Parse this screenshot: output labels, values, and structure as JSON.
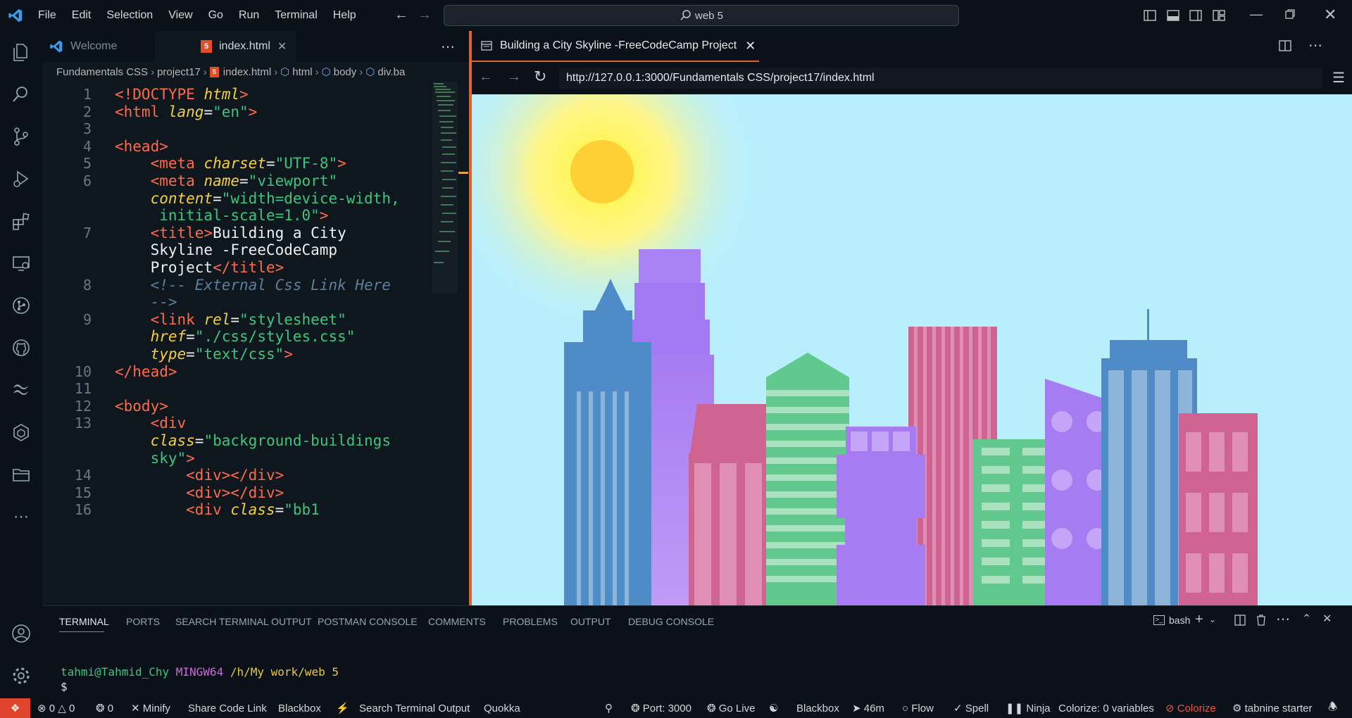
{
  "menu": [
    "File",
    "Edit",
    "Selection",
    "View",
    "Go",
    "Run",
    "Terminal",
    "Help"
  ],
  "search": {
    "text": "web 5"
  },
  "tabs": {
    "welcome": "Welcome",
    "index": "index.html"
  },
  "breadcrumb": [
    "Fundamentals CSS",
    "project17",
    "index.html",
    "html",
    "body",
    "div.ba"
  ],
  "code_lines": [
    {
      "n": "1",
      "parts": [
        [
          "tg",
          "<!DOCTYPE "
        ],
        [
          "at",
          "html"
        ],
        [
          "tg",
          ">"
        ]
      ]
    },
    {
      "n": "2",
      "parts": [
        [
          "tg",
          "<html "
        ],
        [
          "at",
          "lang"
        ],
        [
          "tx",
          "="
        ],
        [
          "st",
          "\"en\""
        ],
        [
          "tg",
          ">"
        ]
      ]
    },
    {
      "n": "3",
      "parts": []
    },
    {
      "n": "4",
      "parts": [
        [
          "tg",
          "<head>"
        ]
      ]
    },
    {
      "n": "5",
      "parts": [
        [
          "tx",
          "    "
        ],
        [
          "tg",
          "<meta "
        ],
        [
          "at",
          "charset"
        ],
        [
          "tx",
          "="
        ],
        [
          "st",
          "\"UTF-8\""
        ],
        [
          "tg",
          ">"
        ]
      ]
    },
    {
      "n": "6",
      "parts": [
        [
          "tx",
          "    "
        ],
        [
          "tg",
          "<meta "
        ],
        [
          "at",
          "name"
        ],
        [
          "tx",
          "="
        ],
        [
          "st",
          "\"viewport\""
        ]
      ]
    },
    {
      "n": "",
      "parts": [
        [
          "tx",
          "    "
        ],
        [
          "at",
          "content"
        ],
        [
          "tx",
          "="
        ],
        [
          "st",
          "\"width=device-width,"
        ]
      ]
    },
    {
      "n": "",
      "parts": [
        [
          "st",
          "     initial-scale=1.0\""
        ],
        [
          "tg",
          ">"
        ]
      ]
    },
    {
      "n": "7",
      "parts": [
        [
          "tx",
          "    "
        ],
        [
          "tg",
          "<title>"
        ],
        [
          "tx",
          "Building a City"
        ]
      ]
    },
    {
      "n": "",
      "parts": [
        [
          "tx",
          "    Skyline -FreeCodeCamp"
        ]
      ]
    },
    {
      "n": "",
      "parts": [
        [
          "tx",
          "    Project"
        ],
        [
          "tg",
          "</title>"
        ]
      ]
    },
    {
      "n": "8",
      "parts": [
        [
          "tx",
          "    "
        ],
        [
          "cm",
          "<!-- External Css Link Here"
        ]
      ]
    },
    {
      "n": "",
      "parts": [
        [
          "cm",
          "    -->"
        ]
      ]
    },
    {
      "n": "9",
      "parts": [
        [
          "tx",
          "    "
        ],
        [
          "tg",
          "<link "
        ],
        [
          "at",
          "rel"
        ],
        [
          "tx",
          "="
        ],
        [
          "st",
          "\"stylesheet\""
        ]
      ]
    },
    {
      "n": "",
      "parts": [
        [
          "tx",
          "    "
        ],
        [
          "at",
          "href"
        ],
        [
          "tx",
          "="
        ],
        [
          "st",
          "\"./css/styles.css\""
        ]
      ]
    },
    {
      "n": "",
      "parts": [
        [
          "tx",
          "    "
        ],
        [
          "at",
          "type"
        ],
        [
          "tx",
          "="
        ],
        [
          "st",
          "\"text/css\""
        ],
        [
          "tg",
          ">"
        ]
      ]
    },
    {
      "n": "10",
      "parts": [
        [
          "tg",
          "</head>"
        ]
      ]
    },
    {
      "n": "11",
      "parts": []
    },
    {
      "n": "12",
      "parts": [
        [
          "tg",
          "<body>"
        ]
      ]
    },
    {
      "n": "13",
      "parts": [
        [
          "tx",
          "    "
        ],
        [
          "tg",
          "<div"
        ]
      ]
    },
    {
      "n": "",
      "parts": [
        [
          "tx",
          "    "
        ],
        [
          "at",
          "class"
        ],
        [
          "tx",
          "="
        ],
        [
          "st",
          "\"background-buildings"
        ]
      ]
    },
    {
      "n": "",
      "parts": [
        [
          "st",
          "    sky\""
        ],
        [
          "tg",
          ">"
        ]
      ]
    },
    {
      "n": "14",
      "parts": [
        [
          "tx",
          "        "
        ],
        [
          "tg",
          "<div></div>"
        ]
      ]
    },
    {
      "n": "15",
      "parts": [
        [
          "tx",
          "        "
        ],
        [
          "tg",
          "<div></div>"
        ]
      ]
    },
    {
      "n": "16",
      "parts": [
        [
          "tx",
          "        "
        ],
        [
          "tg",
          "<div "
        ],
        [
          "at",
          "class"
        ],
        [
          "tx",
          "="
        ],
        [
          "st",
          "\"bb1"
        ]
      ]
    }
  ],
  "browser": {
    "tab_title": "Building a City Skyline -FreeCodeCamp Project",
    "url": "http://127.0.0.1:3000/Fundamentals CSS/project17/index.html"
  },
  "panel": {
    "tabs": [
      "TERMINAL",
      "PORTS",
      "SEARCH TERMINAL OUTPUT",
      "POSTMAN CONSOLE",
      "COMMENTS",
      "PROBLEMS",
      "OUTPUT",
      "DEBUG CONSOLE"
    ],
    "shell": "bash",
    "prompt_user": "tahmi@Tahmid_Chy",
    "prompt_sys": "MINGW64",
    "prompt_path": "/h/My work/web 5",
    "prompt_char": "$"
  },
  "status": {
    "errors": "0",
    "warnings": "0",
    "ports_count": "0",
    "minify": "Minify",
    "share": "Share Code Link",
    "blackbox": "Blackbox",
    "search_output": "Search Terminal Output",
    "quokka": "Quokka",
    "port": "Port: 3000",
    "golive": "Go Live",
    "blackbox2": "Blackbox",
    "time": "46m",
    "flow": "Flow",
    "spell": "Spell",
    "ninja": "Ninja",
    "colorize_vars": "Colorize: 0 variables",
    "colorize": "Colorize",
    "tabnine": "tabnine starter"
  },
  "colors": {
    "accent": "#e0642c",
    "sky": "#b9effd",
    "sun": "#ffcf33"
  }
}
